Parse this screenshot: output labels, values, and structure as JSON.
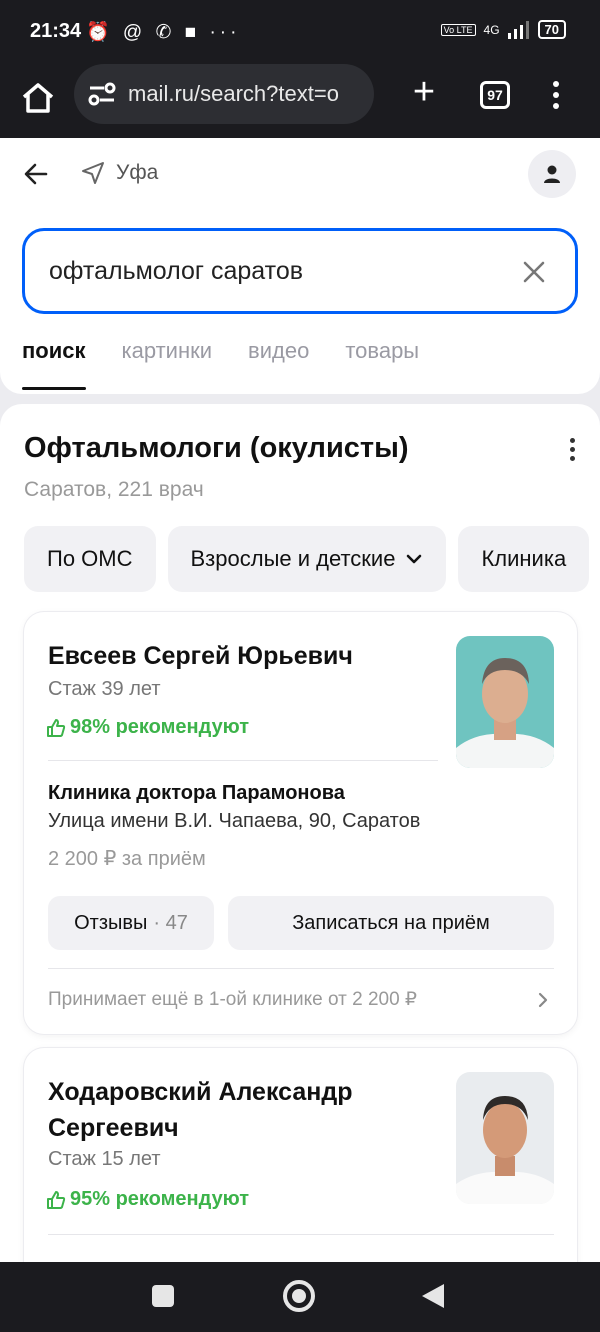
{
  "statusbar": {
    "time": "21:34",
    "icons": "⏰ @ ✆ ■ ···",
    "network": "4G",
    "volte": "Vo LTE",
    "battery": "70"
  },
  "browser": {
    "url": "mail.ru/search?text=o",
    "tabs_count": "97",
    "home_icon": "home-icon",
    "plus_icon": "plus-icon",
    "menu_icon": "more-vert-icon"
  },
  "header": {
    "location": "Уфа"
  },
  "search": {
    "query": "офтальмолог саратов"
  },
  "tabs": [
    "поиск",
    "картинки",
    "видео",
    "товары"
  ],
  "result": {
    "title": "Офтальмологи (окулисты)",
    "subtitle": "Саратов, 221 врач",
    "chips": [
      "По ОМС",
      "Взрослые и детские",
      "Клиника"
    ],
    "doctors": [
      {
        "name": "Евсеев Сергей Юрьевич",
        "experience": "Стаж 39 лет",
        "recommend": "98% рекомендуют",
        "clinic": "Клиника доктора Парамонова",
        "address": "Улица имени В.И. Чапаева, 90, Саратов",
        "price": "2 200 ₽ за приём",
        "reviews_label": "Отзывы",
        "reviews_count": "· 47",
        "book_label": "Записаться на приём",
        "more_clinics": "Принимает ещё в 1-ой клинике от 2 200 ₽"
      },
      {
        "name": "Ходаровский Александр Сергеевич",
        "experience": "Стаж 15 лет",
        "recommend": "95% рекомендуют"
      }
    ]
  },
  "colors": {
    "accent": "#005ff9",
    "recommend": "#3cb34a",
    "bar": "#1b1b1f"
  }
}
